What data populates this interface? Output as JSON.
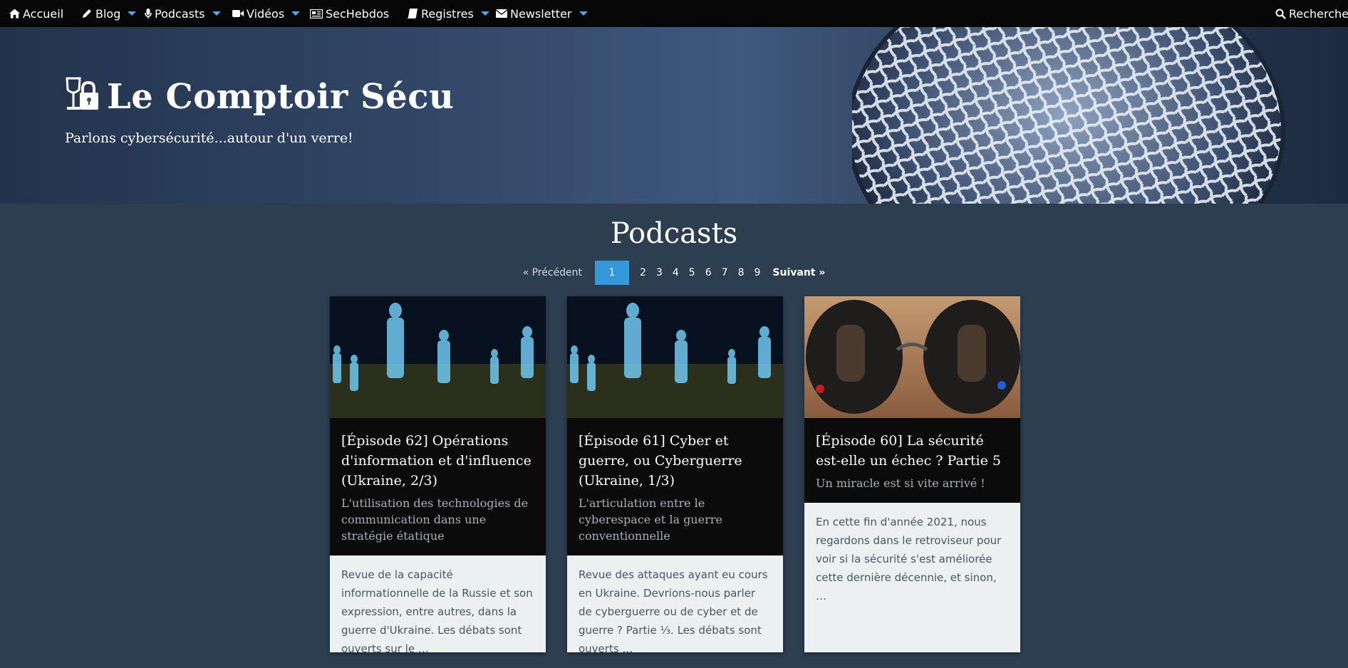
{
  "nav": {
    "items": [
      {
        "label": "Accueil",
        "icon": "home-icon",
        "dropdown": false
      },
      {
        "label": "Blog",
        "icon": "pencil-icon",
        "dropdown": true
      },
      {
        "label": "Podcasts",
        "icon": "microphone-icon",
        "dropdown": true
      },
      {
        "label": "Vidéos",
        "icon": "video-camera-icon",
        "dropdown": true
      },
      {
        "label": "SecHebdos",
        "icon": "newspaper-icon",
        "dropdown": false
      },
      {
        "label": "Registres",
        "icon": "book-icon",
        "dropdown": true
      },
      {
        "label": "Newsletter",
        "icon": "envelope-icon",
        "dropdown": true
      }
    ],
    "search_label": "Recherche"
  },
  "header": {
    "site_title": "Le Comptoir Sécu",
    "tagline": "Parlons cybersécurité...autour d'un verre!"
  },
  "page_title": "Podcasts",
  "pagination": {
    "prev": "«  Précédent",
    "pages": [
      "1",
      "2",
      "3",
      "4",
      "5",
      "6",
      "7",
      "8",
      "9"
    ],
    "current": "1",
    "next": "Suivant  »"
  },
  "cards": [
    {
      "title": "[Épisode 62] Opérations d'information et d'influence (Ukraine, 2/3)",
      "subtitle": "L'utilisation des technologies de communication dans une stratégie étatique",
      "excerpt": "Revue de la capacité informationnelle de la Russie et son expression, entre autres, dans la guerre d'Ukraine. Les débats sont ouverts sur le …",
      "thumb": "matrix-figures-image"
    },
    {
      "title": "[Épisode 61] Cyber et guerre, ou Cyberguerre (Ukraine, 1/3)",
      "subtitle": "L'articulation entre le cyberespace et la guerre conventionnelle",
      "excerpt": "Revue des attaques ayant eu cours en Ukraine. Devrions-nous parler de cyberguerre ou de cyber et de guerre ? Partie ¹⁄₃. Les débats sont ouverts …",
      "thumb": "matrix-figures-image"
    },
    {
      "title": "[Épisode 60] La sécurité est-elle un échec ? Partie 5",
      "subtitle": "Un miracle est si vite arrivé !",
      "excerpt": "En cette fin d'année 2021, nous regardons dans le retroviseur pour voir si la sécurité s'est améliorée cette dernière décennie, et sinon, …",
      "thumb": "sunglasses-reflection-image"
    }
  ]
}
